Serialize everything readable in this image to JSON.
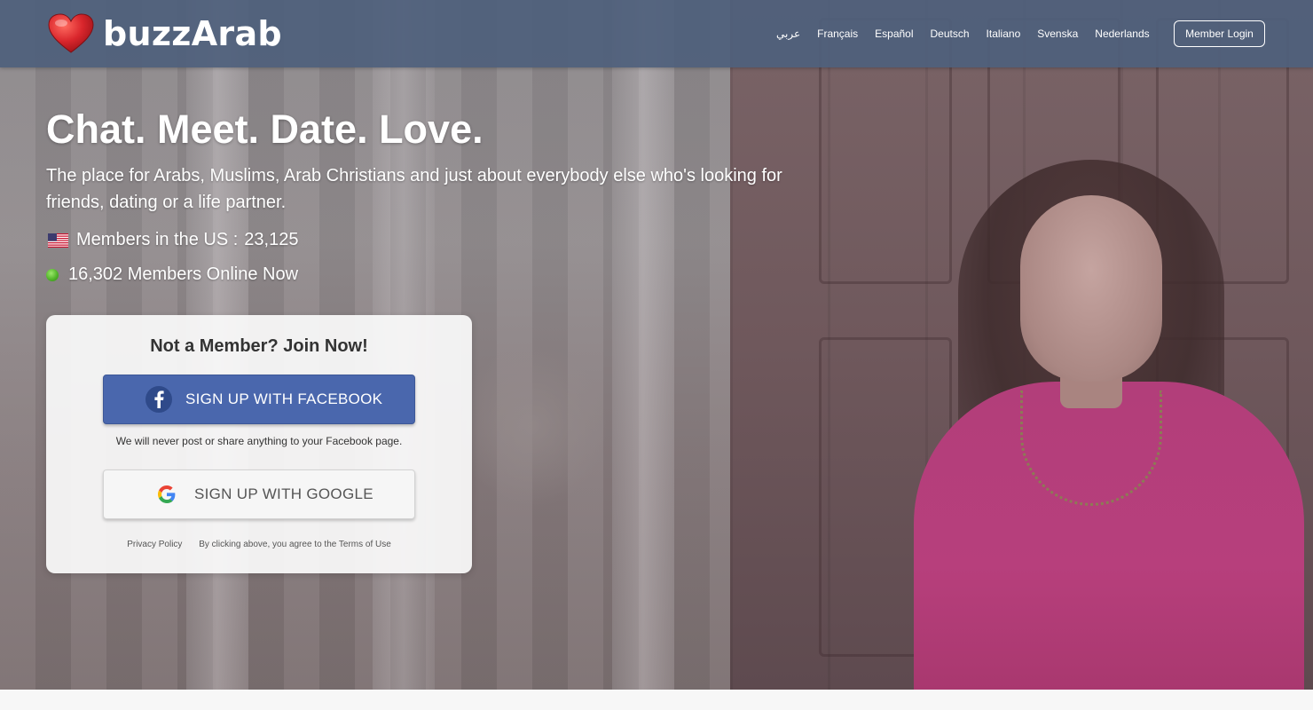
{
  "brand": {
    "name": "buzzArab"
  },
  "nav": {
    "languages": [
      "عربي",
      "Français",
      "Español",
      "Deutsch",
      "Italiano",
      "Svenska",
      "Nederlands"
    ],
    "login_label": "Member Login"
  },
  "hero": {
    "headline": "Chat. Meet. Date. Love.",
    "tagline": "The place for Arabs, Muslims, Arab Christians and just about everybody else who's looking for friends, dating or a life partner.",
    "members_label": "Members in the US :",
    "members_count": "23,125",
    "online_text": "16,302 Members Online Now"
  },
  "signup": {
    "title": "Not a Member? Join Now!",
    "facebook_label": "SIGN UP WITH FACEBOOK",
    "facebook_note": "We will never post or share anything to your Facebook page.",
    "google_label": "SIGN UP WITH GOOGLE",
    "privacy_label": "Privacy Policy",
    "terms_text": "By clicking above, you agree to the Terms of Use"
  },
  "colors": {
    "navbar": "#4e607c",
    "facebook": "#4a67ad",
    "online": "#52b52a",
    "heart": "#d9262c"
  },
  "icons": [
    "heart-logo-icon",
    "us-flag-icon",
    "online-status-icon",
    "facebook-icon",
    "google-icon"
  ]
}
